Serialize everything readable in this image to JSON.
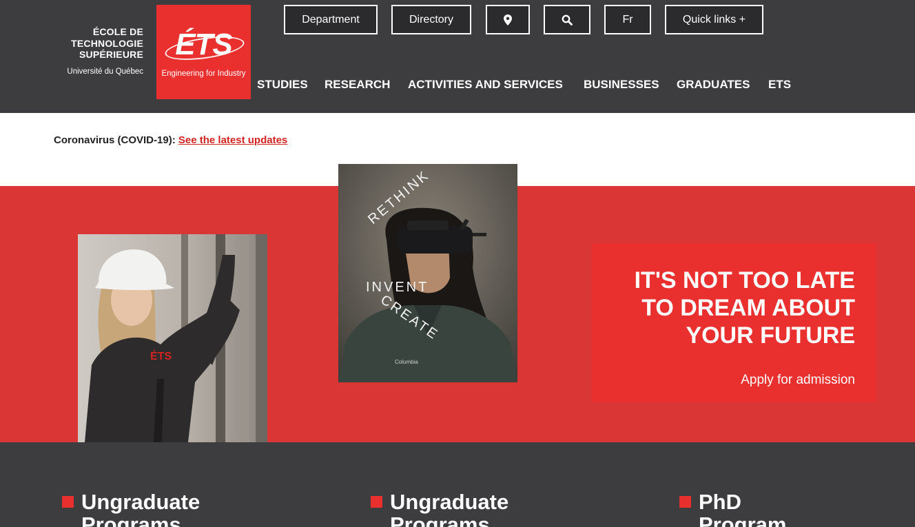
{
  "school": {
    "name_lines": [
      "ÉCOLE DE",
      "TECHNOLOGIE",
      "SUPÉRIEURE"
    ],
    "university": "Université du Québec",
    "logo_text": "ÉTS",
    "logo_tagline": "Engineering for Industry"
  },
  "top_buttons": {
    "department": "Department",
    "directory": "Directory",
    "location_icon": "map-marker-icon",
    "search_icon": "search-icon",
    "language": "Fr",
    "quick_links": "Quick links +"
  },
  "nav": [
    "STUDIES",
    "RESEARCH",
    "ACTIVITIES AND SERVICES",
    "BUSINESSES",
    "GRADUATES",
    "ETS"
  ],
  "covid": {
    "label": "Coronavirus (COVID-19):",
    "link": "See the latest updates"
  },
  "hero": {
    "vr_words": [
      "INVENT",
      "RETHINK",
      "CREATE"
    ],
    "worker_jacket": "ÉTS",
    "headline_lines": [
      "IT'S NOT TOO LATE",
      "TO DREAM ABOUT",
      "YOUR FUTURE"
    ],
    "cta": "Apply for admission"
  },
  "programs": [
    {
      "line1": "Ungraduate",
      "line2": "Programs"
    },
    {
      "line1": "Ungraduate",
      "line2": "Programs"
    },
    {
      "line1": "PhD",
      "line2": "Program"
    }
  ],
  "colors": {
    "header_bg": "#3d3d3f",
    "brand_red": "#e9302e",
    "hero_red": "#da3636",
    "link_red": "#d32421"
  }
}
